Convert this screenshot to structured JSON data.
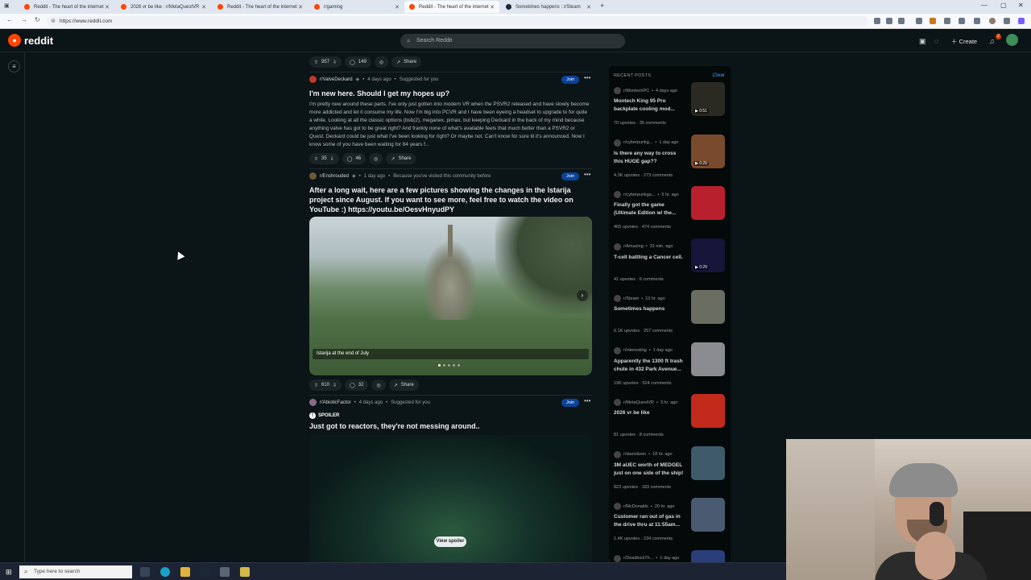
{
  "browser": {
    "tabs": [
      {
        "label": "Reddit - The heart of the internet",
        "active": false
      },
      {
        "label": "2026 vr be like : r/MetaQuestVR",
        "active": false
      },
      {
        "label": "Reddit - The heart of the internet",
        "active": false
      },
      {
        "label": "r/gaming",
        "active": false
      },
      {
        "label": "Reddit - The heart of the internet",
        "active": true
      },
      {
        "label": "Sometimes happens : r/Steam",
        "active": false
      }
    ],
    "new_tab": "+",
    "url": "https://www.reddit.com"
  },
  "header": {
    "logo_text": "reddit",
    "search_placeholder": "Search Reddit",
    "create_label": "Create",
    "notification_count": "2"
  },
  "feed": {
    "top_actions": {
      "votes": "957",
      "comments": "149",
      "share": "Share"
    },
    "posts": [
      {
        "subreddit": "r/ValveDeckard",
        "time": "4 days ago",
        "reason": "Suggested for you",
        "join": "Join",
        "title": "I'm new here. Should I get my hopes up?",
        "body": "I'm pretty new around these parts. I've only just gotten into modern VR when the PSVR2 released and have slowly become more addicted and let it consume my life. Now I'm big into PCVR and I have been eyeing a headset to upgrade to for quite a while. Looking at all the classic options (bsb(2), meganex, pimax, but keeping Deckard in the back of my mind because anything valve has got to be great right? And frankly none of what's available feels that much better than a PSVR2 or Quest. Deckard could be just what I've been looking for right? Or maybe not. Can't know for sure til it's announced. Now I know some of you have been waiting for 84 years f...",
        "votes": "35",
        "comments": "46",
        "share": "Share"
      },
      {
        "subreddit": "r/Enshrouded",
        "time": "1 day ago",
        "reason": "Because you've visited this community before",
        "join": "Join",
        "title": "After a long wait, here are a few pictures showing the changes in the Istarija project since August. If you want to see more, feel free to watch the video on YouTube :) https://youtu.be/OesvHnyudPY",
        "caption": "Istarija at the end of July",
        "votes": "610",
        "comments": "32",
        "share": "Share"
      },
      {
        "subreddit": "r/AbioticFactor",
        "time": "4 days ago",
        "reason": "Suggested for you",
        "join": "Join",
        "spoiler": "SPOILER",
        "title": "Just got to reactors, they're not messing around..",
        "view_spoiler": "View spoiler"
      }
    ]
  },
  "recent": {
    "heading": "RECENT POSTS",
    "clear": "Clear",
    "items": [
      {
        "sub": "r/MontechPC",
        "time": "4 days ago",
        "title": "Montech King 95 Pro backplate cooling mod...",
        "upvotes": "70 upvotes",
        "comments": "35 comments",
        "duration": "0:51",
        "thumb": "#2a2a22"
      },
      {
        "sub": "r/cyberpunkg...",
        "time": "1 day ago",
        "title": "Is there any way to cross this HUGE gap??",
        "upvotes": "4.3K upvotes",
        "comments": "273 comments",
        "duration": "0:29",
        "thumb": "#7a4a2c"
      },
      {
        "sub": "r/cyberpunkga...",
        "time": "5 hr. ago",
        "title": "Finally got the game (Ultimate Edition w/ the...",
        "upvotes": "465 upvotes",
        "comments": "474 comments",
        "duration": "",
        "thumb": "#b8202e"
      },
      {
        "sub": "r/Amazing",
        "time": "31 min. ago",
        "title": "T-cell battling a Cancer cell.",
        "upvotes": "41 upvotes",
        "comments": "6 comments",
        "duration": "0:29",
        "thumb": "#15163a"
      },
      {
        "sub": "r/Steam",
        "time": "13 hr. ago",
        "title": "Sometimes happens",
        "upvotes": "6.1K upvotes",
        "comments": "257 comments",
        "duration": "",
        "thumb": "#6a6e62"
      },
      {
        "sub": "r/interesting",
        "time": "1 day ago",
        "title": "Apparently the 1300 ft trash chute in 432 Park Avenue...",
        "upvotes": "19K upvotes",
        "comments": "524 comments",
        "duration": "",
        "thumb": "#8a8c90"
      },
      {
        "sub": "r/MetaQuestVR",
        "time": "3 hr. ago",
        "title": "2026 vr be like",
        "upvotes": "81 upvotes",
        "comments": "8 comments",
        "duration": "",
        "thumb": "#c22a1c"
      },
      {
        "sub": "r/starcitizen",
        "time": "18 hr. ago",
        "title": "3M aUEC worth of MEDGEL just on one side of the ship!",
        "upvotes": "823 upvotes",
        "comments": "183 comments",
        "duration": "",
        "thumb": "#3f5a6a"
      },
      {
        "sub": "r/McDonalds",
        "time": "20 hr. ago",
        "title": "Customer ran out of gas in the drive thru at 11:55am...",
        "upvotes": "1.4K upvotes",
        "comments": "234 comments",
        "duration": "",
        "thumb": "#4a5a70"
      },
      {
        "sub": "r/DeadlockTh...",
        "time": "1 day ago",
        "title": "",
        "upvotes": "",
        "comments": "",
        "duration": "",
        "thumb": "#2a3f7a"
      }
    ]
  },
  "taskbar": {
    "search_placeholder": "Type here to search"
  },
  "colors": {
    "bg": "#0b1416",
    "join": "#0a449b",
    "accent": "#ff4500",
    "link": "#4f9ef9"
  }
}
